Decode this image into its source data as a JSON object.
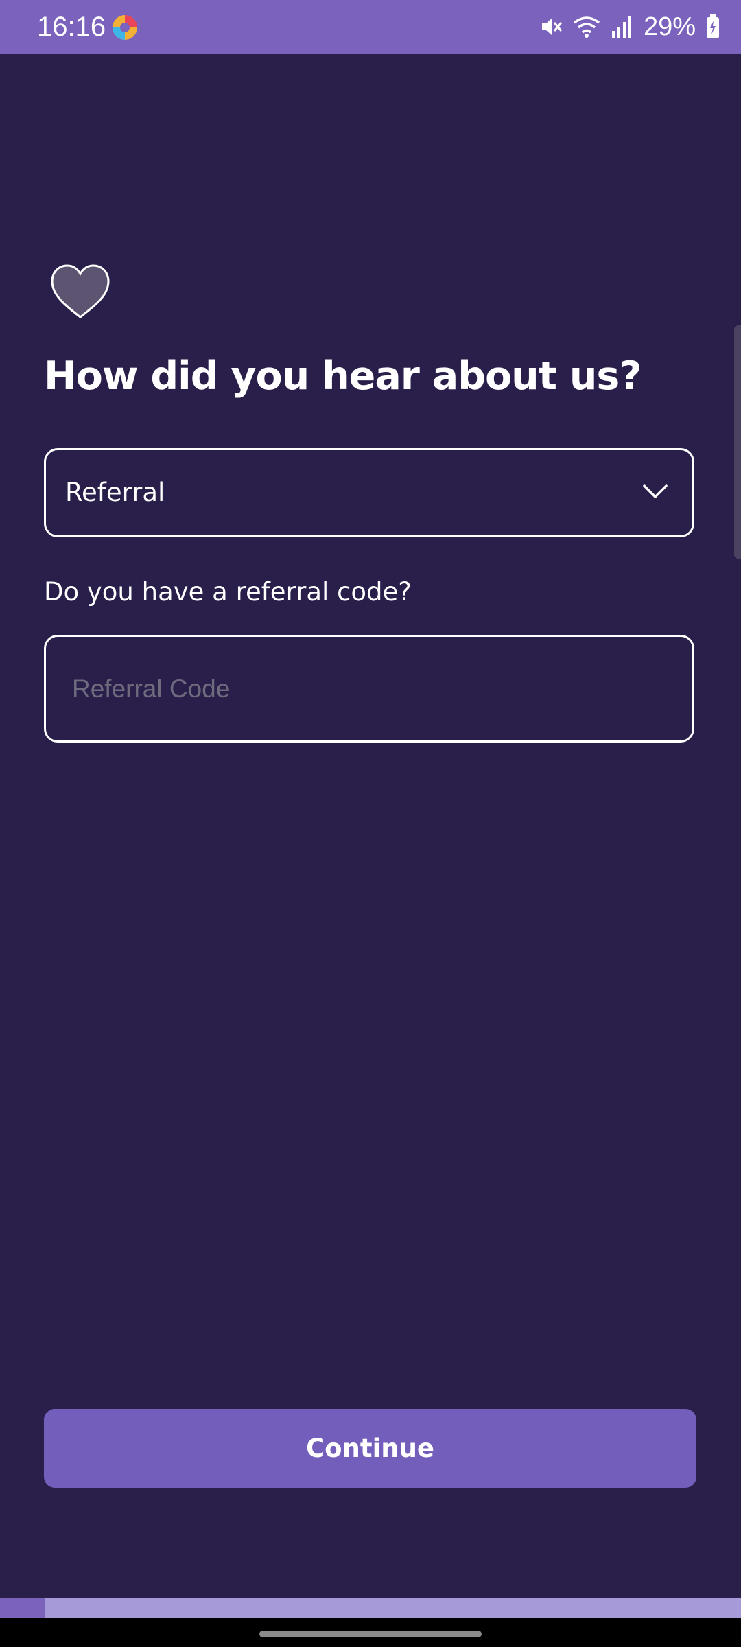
{
  "status_bar": {
    "time": "16:16",
    "battery": "29%",
    "icons": [
      "app-logo-icon",
      "mute-icon",
      "wifi-icon",
      "signal-icon",
      "battery-charging-icon"
    ]
  },
  "form": {
    "icon": "heart-icon",
    "title": "How did you hear about us?",
    "source_select": {
      "value": "Referral",
      "icon": "chevron-down-icon"
    },
    "referral_question": "Do you have a referral code?",
    "referral_code_input": {
      "value": "",
      "placeholder": "Referral Code"
    },
    "continue_label": "Continue"
  },
  "progress": {
    "fraction": 0.06
  },
  "colors": {
    "background": "#291f4a",
    "accent": "#7b63bd",
    "button": "#735fbb",
    "progress_track": "#a79ad8"
  }
}
